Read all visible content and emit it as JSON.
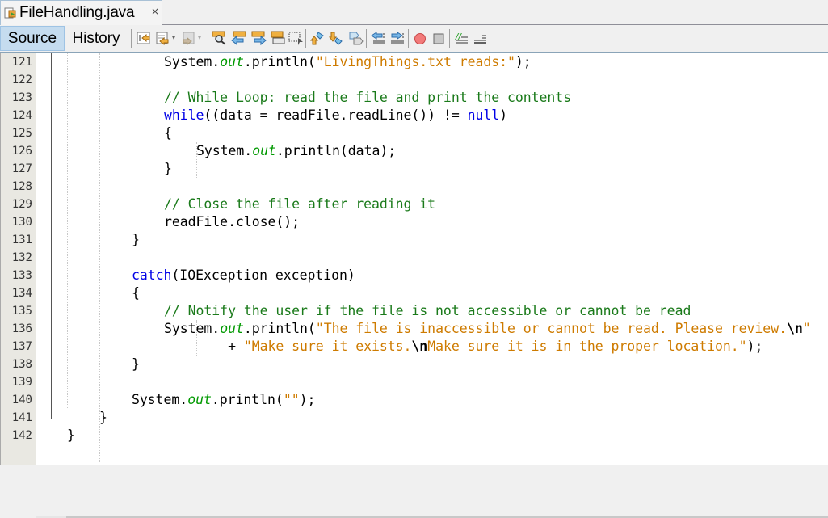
{
  "tab": {
    "title": "FileHandling.java",
    "close_glyph": "×",
    "icon": "java-file-icon"
  },
  "toolbar": {
    "source_label": "Source",
    "history_label": "History",
    "icons": [
      "last-edit-icon",
      "back-icon",
      "forward-icon",
      "find-selection-icon",
      "find-previous-icon",
      "find-next-icon",
      "toggle-highlight-icon",
      "toggle-rectangular-selection-icon",
      "previous-bookmark-icon",
      "next-bookmark-icon",
      "toggle-bookmark-icon",
      "shift-left-icon",
      "shift-right-icon",
      "start-macro-icon",
      "stop-macro-icon",
      "comment-icon",
      "uncomment-icon"
    ]
  },
  "editor": {
    "colors": {
      "keyword": "#0000e6",
      "field": "#009900",
      "string": "#ce7b00",
      "comment": "#1a7a1a"
    },
    "lines": [
      {
        "num": "121",
        "indent": 3,
        "tokens": [
          [
            "t",
            "System."
          ],
          [
            "fld",
            "out"
          ],
          [
            "t",
            ".println("
          ],
          [
            "str",
            "\"LivingThings.txt reads:\""
          ],
          [
            "t",
            ");"
          ]
        ]
      },
      {
        "num": "122",
        "indent": 0,
        "tokens": []
      },
      {
        "num": "123",
        "indent": 3,
        "tokens": [
          [
            "cmt",
            "// While Loop: read the file and print the contents"
          ]
        ]
      },
      {
        "num": "124",
        "indent": 3,
        "tokens": [
          [
            "kw",
            "while"
          ],
          [
            "t",
            "((data = readFile.readLine()) != "
          ],
          [
            "kw",
            "null"
          ],
          [
            "t",
            ")"
          ]
        ]
      },
      {
        "num": "125",
        "indent": 3,
        "tokens": [
          [
            "t",
            "{"
          ]
        ]
      },
      {
        "num": "126",
        "indent": 4,
        "tokens": [
          [
            "t",
            "System."
          ],
          [
            "fld",
            "out"
          ],
          [
            "t",
            ".println(data);"
          ]
        ]
      },
      {
        "num": "127",
        "indent": 3,
        "tokens": [
          [
            "t",
            "}"
          ]
        ]
      },
      {
        "num": "128",
        "indent": 0,
        "tokens": []
      },
      {
        "num": "129",
        "indent": 3,
        "tokens": [
          [
            "cmt",
            "// Close the file after reading it"
          ]
        ]
      },
      {
        "num": "130",
        "indent": 3,
        "tokens": [
          [
            "t",
            "readFile.close();"
          ]
        ]
      },
      {
        "num": "131",
        "indent": 2,
        "tokens": [
          [
            "t",
            "}"
          ]
        ]
      },
      {
        "num": "132",
        "indent": 0,
        "tokens": []
      },
      {
        "num": "133",
        "indent": 2,
        "tokens": [
          [
            "kw",
            "catch"
          ],
          [
            "t",
            "(IOException exception)"
          ]
        ]
      },
      {
        "num": "134",
        "indent": 2,
        "tokens": [
          [
            "t",
            "{"
          ]
        ]
      },
      {
        "num": "135",
        "indent": 3,
        "tokens": [
          [
            "cmt",
            "// Notify the user if the file is not accessible or cannot be read"
          ]
        ]
      },
      {
        "num": "136",
        "indent": 3,
        "tokens": [
          [
            "t",
            "System."
          ],
          [
            "fld",
            "out"
          ],
          [
            "t",
            ".println("
          ],
          [
            "str",
            "\"The file is inaccessible or cannot be read. Please review."
          ],
          [
            "esc",
            "\\n"
          ],
          [
            "str",
            "\""
          ]
        ]
      },
      {
        "num": "137",
        "indent": 5,
        "tokens": [
          [
            "t",
            "  + "
          ],
          [
            "str",
            "\"Make sure it exists."
          ],
          [
            "esc",
            "\\n"
          ],
          [
            "str",
            "Make sure it is in the proper location.\""
          ],
          [
            "t",
            ");"
          ]
        ]
      },
      {
        "num": "138",
        "indent": 2,
        "tokens": [
          [
            "t",
            "}"
          ]
        ]
      },
      {
        "num": "139",
        "indent": 0,
        "tokens": []
      },
      {
        "num": "140",
        "indent": 2,
        "tokens": [
          [
            "t",
            "System."
          ],
          [
            "fld",
            "out"
          ],
          [
            "t",
            ".println("
          ],
          [
            "str",
            "\"\""
          ],
          [
            "t",
            ");"
          ]
        ]
      },
      {
        "num": "141",
        "indent": 1,
        "tokens": [
          [
            "t",
            "}"
          ]
        ]
      },
      {
        "num": "142",
        "indent": 0,
        "tokens": [
          [
            "t",
            "}"
          ]
        ]
      }
    ]
  }
}
